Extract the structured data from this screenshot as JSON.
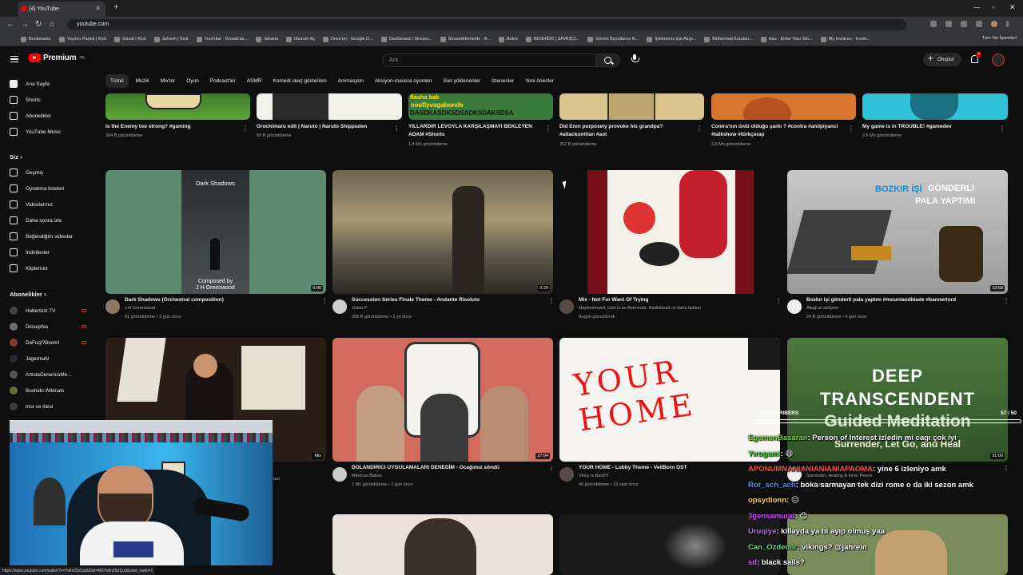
{
  "browser": {
    "tab_title": "(4) YouTube",
    "url": "youtube.com",
    "bookmarks": [
      "Bookmarks",
      "Yayıncı Paneli | Kick",
      "Gözat | Kick",
      "Jahrein | Kick",
      "YouTube - Broadcas...",
      "Jaharia",
      "Oturum Aç",
      "Drive'ım - Google D...",
      "Dashboard / Stream...",
      "StreamElements - A...",
      "Botrix",
      "BUSHIDO | SAVAŞÇI...",
      "Görsel Boyutlarını N...",
      "İşletmeniz için Alışv...",
      "Mühimmat Kutuları...",
      "ikas - Enter Your Sto...",
      "My Invoices - Invoic..."
    ],
    "bookmarks_right": "Tüm Yer İşaretleri",
    "status_url": "https://www.youtube.com/watch?v=Yv8n25d1ju0&list=RDYv8n25d1ju0&start_radio=1"
  },
  "header": {
    "logo_text": "Premium",
    "logo_sup": "TR",
    "search_placeholder": "Ara",
    "create_label": "Oluştur",
    "notification_count": "4"
  },
  "chips": [
    "Tümü",
    "Müzik",
    "Mix'ler",
    "Oyun",
    "Podcast'ler",
    "ASMR",
    "Komedi skeç gösterileri",
    "Animasyon",
    "Aksiyon-macera oyunları",
    "Son yüklenenler",
    "İzlenenler",
    "Yeni öneriler"
  ],
  "sidebar": {
    "main": [
      "Ana Sayfa",
      "Shorts",
      "Abonelikler",
      "YouTube Music"
    ],
    "you_heading": "Siz",
    "you": [
      "Geçmiş",
      "Oynatma listeleri",
      "Videolarınız",
      "Daha sonra izle",
      "Beğendiğim videolar",
      "İndirilenler",
      "Klipleriniz"
    ],
    "subs_heading": "Abonelikler",
    "subs": [
      "Habertürk TV",
      "Diosophia",
      "DaFuq!?Boom!",
      "JagermaN",
      "ArtistaGenericoMe...",
      "Bushido Wildcats",
      "mor ve ötesi"
    ]
  },
  "row0": [
    {
      "title": "Is the Enemy too strong? #gaming",
      "meta": "304 B görüntüleme"
    },
    {
      "title": "Orochimaru edit | Naruto | Naruto Shippuden",
      "meta": "69 B görüntüleme"
    },
    {
      "title": "YILLARDIR LEVOYLA KARŞILAŞMAYI BEKLEYEN ADAM #Shorts",
      "meta": "1,4 Mn görüntüleme",
      "overlay1": "flasha bak",
      "overlay2": "souflyvagabonds",
      "overlay3": "DASDKASDKSDSADKSDAKSDSA"
    },
    {
      "title": "Did Eren purposely provoke his grandpa? #attackontitan #aot",
      "meta": "352 B görüntüleme"
    },
    {
      "title": "Contra'nın ünlü olduğu şarkı ? #contra #anilpiyanci #talkshow #türkçerap",
      "meta": "3,6 Mn görüntüleme"
    },
    {
      "title": "My game is in TROUBLE! #gamedev",
      "meta": "2,6 Mn görüntüleme"
    }
  ],
  "row1": [
    {
      "title": "Dark Shadows (Orchestral composition)",
      "channel": "J H Greenwood",
      "meta": "61 görüntüleme • 2 gün önce",
      "duration": "6:00",
      "thumb_title": "Dark Shadows",
      "thumb_sub1": "Composed by",
      "thumb_sub2": "J H Greenwood"
    },
    {
      "title": "Succession Series Finale Theme - Andante Risoluto",
      "channel": "Julian P",
      "meta": "268 B görüntüleme • 2 yıl önce",
      "duration": "2:29"
    },
    {
      "title": "Mix - Not For Want Of Trying",
      "channel": "Maybeshewill, God Is an Astronaut, Radiohead ve daha fazlası",
      "meta": "Bugün güncellendi"
    },
    {
      "title": "Bozkır işi gönderli pala yaptım #mountandblade #bannerlord",
      "channel": "Altuğ'un atölyesi",
      "meta": "24 B görüntüleme • 4 gün önce",
      "duration": "19:58",
      "thumb_text1": "BOZKIR İŞİ",
      "thumb_text2": "GÖNDERLİ",
      "thumb_text3": "PALA YAPTIM!"
    }
  ],
  "row2": [
    {
      "title": "",
      "channel": "",
      "meta": "",
      "duration": "Mix",
      "partial": "lası"
    },
    {
      "title": "DOLANDIRICI UYGULAMALARI DENEDİM - Ocağımız söndü",
      "channel": "Mevtcan Bahav",
      "meta": "1 Mn görüntüleme • 1 gün önce",
      "duration": "27:04"
    },
    {
      "title": "YOUR HOME - Lobby Theme - VeilBorn OST",
      "channel": "Vinny is Back!!!",
      "meta": "40 görüntüleme • 19 saat önce",
      "thumb_text": "YOUR HOME"
    },
    {
      "title": "",
      "channel": "Surrender, Healing & Inner Peace",
      "meta": "2,1 B görüntüleme • 3 ay önce",
      "duration": "31:00",
      "thumb_text1": "DEEP",
      "thumb_text2": "TRANSCENDENT",
      "thumb_text3": "Guided Meditation",
      "thumb_text4": "Surrender, Let Go, and Heal"
    }
  ],
  "chat": {
    "header": "SUBSCRIBERS",
    "count": "57 / 50",
    "messages": [
      {
        "user": "EgemenBasaran",
        "text": ": Person of Interest izledin mi cagı çok iyi",
        "color": "#7fd14b"
      },
      {
        "user": "Yırogami",
        "text": ": 😄",
        "color": "#4fd84a"
      },
      {
        "user": "APONUMNANIANIANIANIAPAOMA",
        "text": ": yine 6 izleniyo amk",
        "color": "#ff4b4b"
      },
      {
        "user": "Ror_sch_ach",
        "text": ": boka sarmayan tek dizi rome o da iki sezon amk",
        "color": "#5b8cff"
      },
      {
        "user": "opsydionn",
        "text": ": 😐",
        "color": "#ffcc66"
      },
      {
        "user": "3gensamurai",
        "text": ": 😊",
        "color": "#c74bff"
      },
      {
        "user": "Uruqiye",
        "text": ": killayda ya bi ayıp olmuş yaa",
        "color": "#b06bff"
      },
      {
        "user": "Can_Ozdemir",
        "text": ": vikings? @jahrein",
        "color": "#58e07a"
      },
      {
        "user": "sd",
        "text": ": black sails?",
        "color": "#d25cff"
      }
    ]
  },
  "colors": {
    "bg": "#0f0f0f",
    "accent": "#ff0000",
    "chip_active": "#272727"
  }
}
